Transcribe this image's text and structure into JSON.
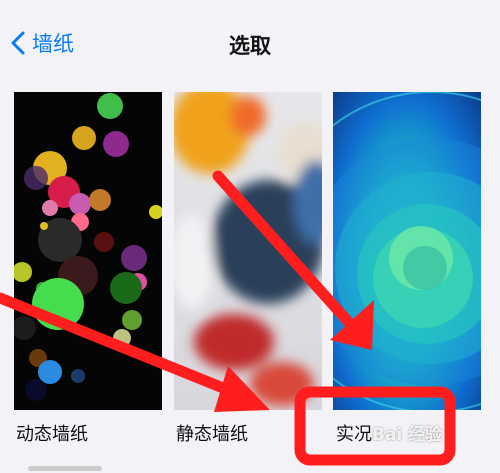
{
  "nav": {
    "back_label": "墙纸",
    "title": "选取"
  },
  "wallpapers": [
    {
      "label": "动态墙纸"
    },
    {
      "label": "静态墙纸"
    },
    {
      "label": "实况"
    }
  ],
  "watermark": "Bai 经验",
  "colors": {
    "accent": "#0a7bf5",
    "annotation_red": "#ff1e1e"
  }
}
